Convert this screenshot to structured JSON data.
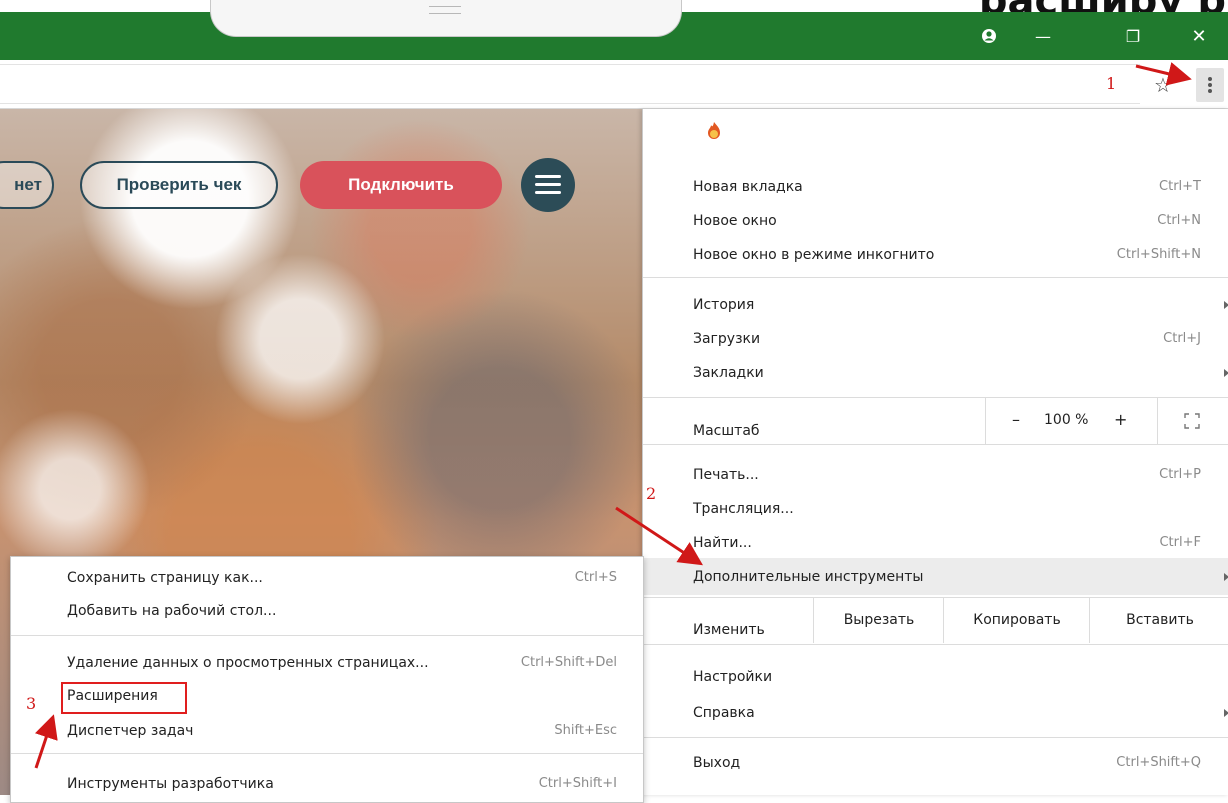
{
  "header": {
    "heading_fragment": "расширу р"
  },
  "window": {
    "minimize": "—",
    "restore": "❐",
    "close": "✕"
  },
  "page": {
    "btn_partial": "нет",
    "btn_check": "Проверить чек",
    "btn_connect": "Подключить"
  },
  "menu": {
    "new_tab": "Новая вкладка",
    "new_tab_sc": "Ctrl+T",
    "new_window": "Новое окно",
    "new_window_sc": "Ctrl+N",
    "incognito": "Новое окно в режиме инкогнито",
    "incognito_sc": "Ctrl+Shift+N",
    "history": "История",
    "downloads": "Загрузки",
    "downloads_sc": "Ctrl+J",
    "bookmarks": "Закладки",
    "zoom_label": "Масштаб",
    "zoom_minus": "–",
    "zoom_value": "100 %",
    "zoom_plus": "+",
    "print": "Печать...",
    "print_sc": "Ctrl+P",
    "cast": "Трансляция...",
    "find": "Найти...",
    "find_sc": "Ctrl+F",
    "more_tools": "Дополнительные инструменты",
    "edit": "Изменить",
    "cut": "Вырезать",
    "copy": "Копировать",
    "paste": "Вставить",
    "settings": "Настройки",
    "help": "Справка",
    "exit": "Выход",
    "exit_sc": "Ctrl+Shift+Q"
  },
  "submenu": {
    "save_page": "Сохранить страницу как...",
    "save_page_sc": "Ctrl+S",
    "add_desktop": "Добавить на рабочий стол...",
    "clear_data": "Удаление данных о просмотренных страницах...",
    "clear_data_sc": "Ctrl+Shift+Del",
    "extensions": "Расширения",
    "task_manager": "Диспетчер задач",
    "task_manager_sc": "Shift+Esc",
    "dev_tools": "Инструменты разработчика",
    "dev_tools_sc": "Ctrl+Shift+I"
  },
  "annotations": {
    "step1": "1",
    "step2": "2",
    "step3": "3"
  },
  "colors": {
    "titlebar": "#207a2e",
    "accent_red": "#d9525b",
    "annotation": "#d01818"
  }
}
